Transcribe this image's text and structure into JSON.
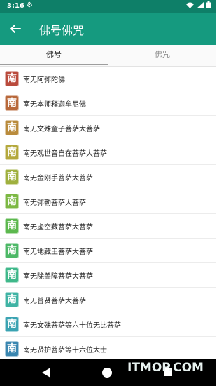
{
  "status": {
    "time": "3:16"
  },
  "toolbar": {
    "title": "佛号佛咒"
  },
  "tabs": [
    {
      "label": "佛号"
    },
    {
      "label": "佛咒"
    }
  ],
  "list": [
    {
      "char": "南",
      "text": "南无阿弥陀佛",
      "color": "#b94a3c"
    },
    {
      "char": "南",
      "text": "南无本师释迦牟尼佛",
      "color": "#b8683a"
    },
    {
      "char": "南",
      "text": "南无文殊童子菩萨大菩萨",
      "color": "#b98b3c"
    },
    {
      "char": "南",
      "text": "南无观世音自在菩萨大菩萨",
      "color": "#b4a83c"
    },
    {
      "char": "南",
      "text": "南无金刚手菩萨大菩萨",
      "color": "#9fb03e"
    },
    {
      "char": "南",
      "text": "南无弥勒菩萨大菩萨",
      "color": "#7cb843"
    },
    {
      "char": "南",
      "text": "南无虚空藏菩萨大菩萨",
      "color": "#5cb84e"
    },
    {
      "char": "南",
      "text": "南无地藏王菩萨大菩萨",
      "color": "#4cb866"
    },
    {
      "char": "南",
      "text": "南无除盖障菩萨大菩萨",
      "color": "#3fb88a"
    },
    {
      "char": "南",
      "text": "南无普贤菩萨大菩萨",
      "color": "#3fb3a4"
    },
    {
      "char": "南",
      "text": "南无文殊菩萨等六十位无比菩萨",
      "color": "#3aa3b2"
    },
    {
      "char": "南",
      "text": "南无贤护菩萨等十六位大士",
      "color": "#3a86b0"
    }
  ],
  "watermark": "ITMOP.COM"
}
